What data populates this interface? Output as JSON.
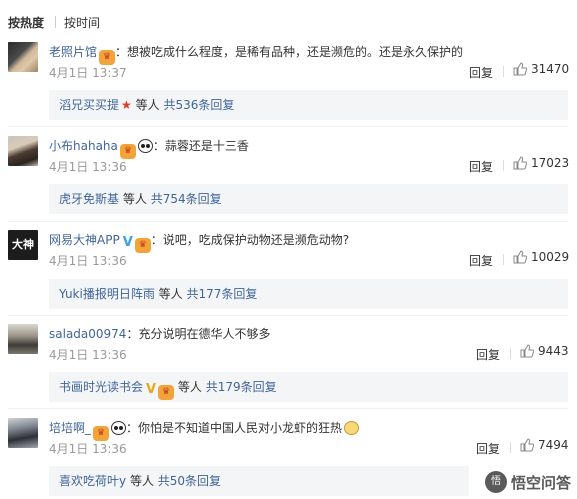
{
  "sort": {
    "active": "按热度",
    "other": "按时间"
  },
  "actions": {
    "reply": "回复"
  },
  "comments": [
    {
      "user": "老照片馆",
      "text": "想被吃成什么程度，是稀有品种，还是濒危的。还是永久保护的",
      "time": "4月1日 13:37",
      "likes": "31470",
      "reply_user": "滔兄买买提",
      "reply_mid": "等人",
      "reply_link": "共536条回复"
    },
    {
      "user": "小布hahaha",
      "text": "蒜蓉还是十三香",
      "time": "4月1日 13:36",
      "likes": "17023",
      "reply_user": "虎牙免斯基",
      "reply_mid": "等人",
      "reply_link": "共754条回复"
    },
    {
      "user": "网易大神APP",
      "text": "说吧，吃成保护动物还是濒危动物?",
      "time": "4月1日 13:36",
      "likes": "10029",
      "reply_user": "Yuki播报明日阵雨",
      "reply_mid": "等人",
      "reply_link": "共177条回复"
    },
    {
      "user": "salada00974",
      "text": "充分说明在德华人不够多",
      "time": "4月1日 13:36",
      "likes": "9443",
      "reply_user": "书画时光读书会",
      "reply_mid": "等人",
      "reply_link": "共179条回复"
    },
    {
      "user": "培培啊_",
      "text": "你怕是不知道中国人民对小龙虾的狂热",
      "time": "4月1日 13:36",
      "likes": "7494",
      "reply_user": "喜欢吃荷叶y",
      "reply_mid": "等人",
      "reply_link": "共50条回复"
    }
  ],
  "avatar3_label": "大神",
  "watermark": {
    "mark": "悟",
    "text": "悟空问答"
  }
}
